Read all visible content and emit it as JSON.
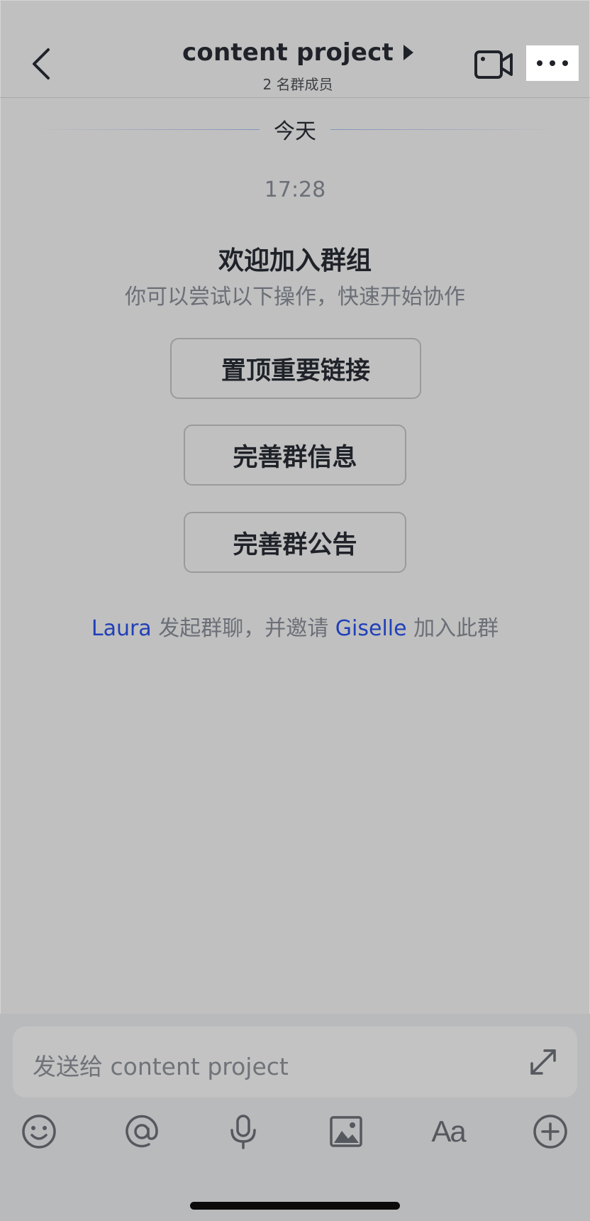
{
  "header": {
    "title": "content project",
    "subtitle": "2 名群成员"
  },
  "chat": {
    "day_divider": "今天",
    "time": "17:28",
    "welcome_title": "欢迎加入群组",
    "welcome_subtitle": "你可以尝试以下操作，快速开始协作",
    "actions": [
      "置顶重要链接",
      "完善群信息",
      "完善群公告"
    ],
    "system_message": {
      "inviter": "Laura",
      "middle": " 发起群聊，并邀请 ",
      "invitee": "Giselle",
      "suffix": " 加入此群"
    }
  },
  "composer": {
    "placeholder": "发送给 content project",
    "toolbar": [
      "emoji-icon",
      "mention-icon",
      "microphone-icon",
      "image-icon",
      "text-format-icon",
      "add-icon"
    ],
    "format_label": "Aa"
  },
  "colors": {
    "background": "#c0c0c0",
    "link_blue": "#2040b8",
    "muted_text": "#6b6f77"
  }
}
